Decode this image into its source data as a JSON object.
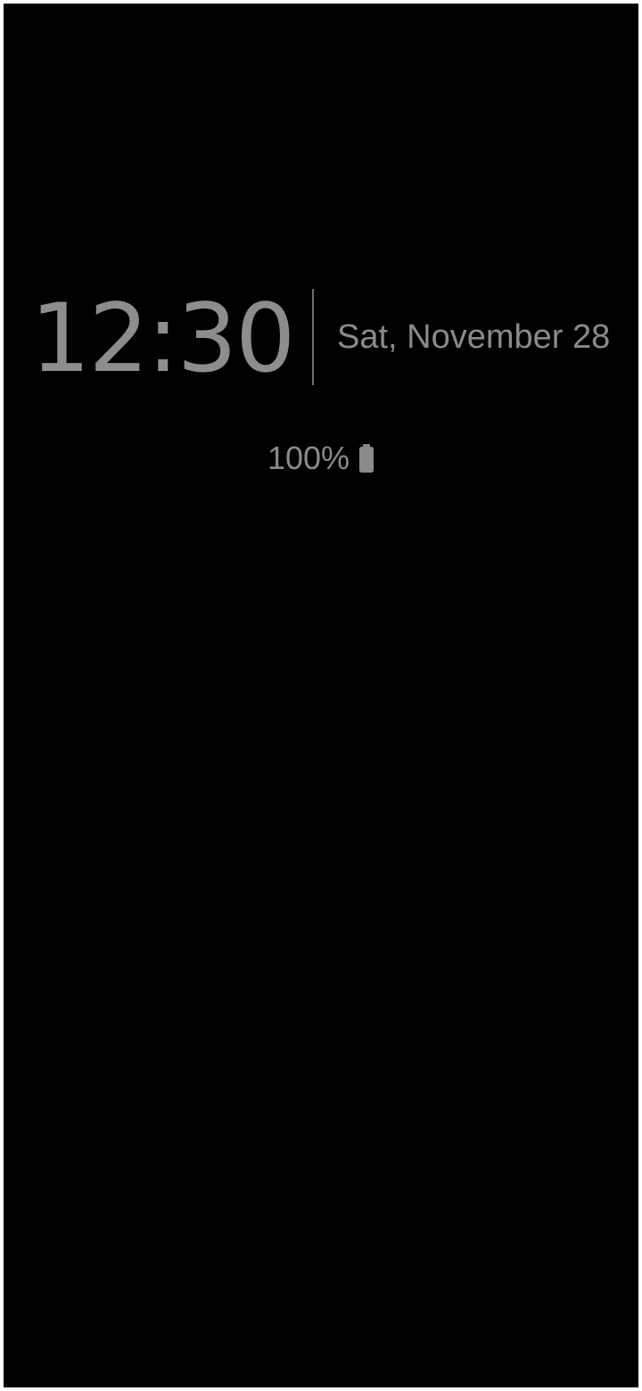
{
  "lock_screen": {
    "time": "12:30",
    "date": "Sat, November 28",
    "battery": {
      "percent_text": "100%",
      "icon": "battery-full-icon"
    }
  },
  "colors": {
    "background": "#000000",
    "text": "#8a8a8a"
  }
}
